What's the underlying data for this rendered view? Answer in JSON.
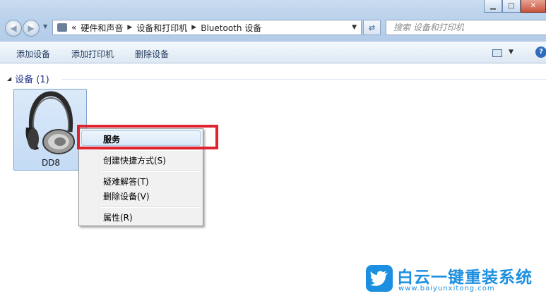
{
  "window": {
    "caption_buttons": [
      "minimize",
      "maximize",
      "close"
    ]
  },
  "address": {
    "overflow": "«",
    "crumbs": [
      "硬件和声音",
      "设备和打印机",
      "Bluetooth 设备"
    ]
  },
  "search": {
    "placeholder": "搜索 设备和打印机"
  },
  "toolbar": {
    "add_device": "添加设备",
    "add_printer": "添加打印机",
    "remove_device": "删除设备"
  },
  "group": {
    "label": "设备 (1)"
  },
  "device": {
    "name": "DD8",
    "icon": "headphones-icon"
  },
  "context_menu": {
    "services": "服务",
    "create_shortcut": "创建快捷方式(S)",
    "troubleshoot": "疑难解答(T)",
    "remove_device": "删除设备(V)",
    "properties": "属性(R)"
  },
  "highlight_color": "#e0232f",
  "watermark": {
    "title": "白云一键重装系统",
    "url": "www.baiyunxitong.com"
  }
}
